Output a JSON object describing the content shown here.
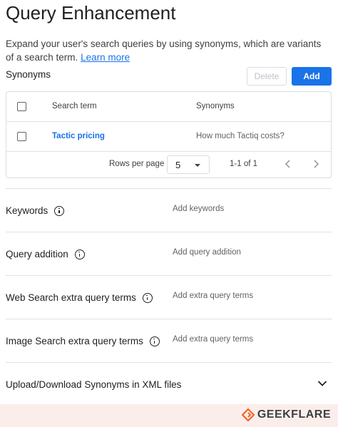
{
  "header": {
    "title": "Query Enhancement",
    "description": "Expand your user's search queries by using synonyms, which are variants of a search term.",
    "learn_more": "Learn more"
  },
  "synonyms": {
    "label": "Synonyms",
    "delete_label": "Delete",
    "add_label": "Add",
    "columns": [
      "Search term",
      "Synonyms"
    ],
    "rows": [
      {
        "term": "Tactic pricing",
        "synonyms": "How much Tactiq costs?"
      }
    ],
    "pager": {
      "rows_per_page_label": "Rows per page",
      "rows_per_page_value": "5",
      "range": "1-1 of 1"
    }
  },
  "sections": [
    {
      "label": "Keywords",
      "placeholder": "Add keywords"
    },
    {
      "label": "Query addition",
      "placeholder": "Add query addition"
    },
    {
      "label": "Web Search extra query terms",
      "placeholder": "Add extra query terms"
    },
    {
      "label": "Image Search extra query terms",
      "placeholder": "Add extra query terms"
    }
  ],
  "upload": {
    "label": "Upload/Download Synonyms in XML files"
  },
  "footer": {
    "brand": "GEEKFLARE"
  },
  "colors": {
    "accent": "#1a73e8",
    "footer_bg": "#fbeeea",
    "brand_orange": "#f26522"
  }
}
